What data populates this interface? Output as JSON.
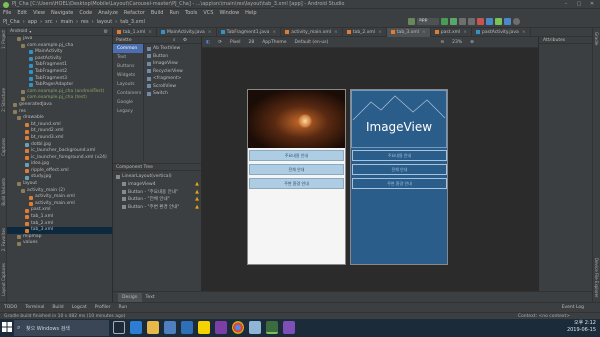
{
  "window": {
    "title": "PJ_Cha [C:\\Users\\HOEL\\Desktop\\Mobile\\Layout\\Carousel-master\\PJ_Cha] - ...\\app\\src\\main\\res\\layout\\tab_3.xml [app] - Android Studio"
  },
  "menu": [
    "File",
    "Edit",
    "View",
    "Navigate",
    "Code",
    "Analyze",
    "Refactor",
    "Build",
    "Run",
    "Tools",
    "VCS",
    "Window",
    "Help"
  ],
  "breadcrumbs": [
    "PJ_Cha",
    "app",
    "src",
    "main",
    "res",
    "layout",
    "tab_3.xml"
  ],
  "run_config": "app",
  "project_panel": {
    "header": "Android",
    "items": [
      {
        "label": "java",
        "indent": 2,
        "kind": "folder"
      },
      {
        "label": "com.example.pj_cha",
        "indent": 3,
        "kind": "package"
      },
      {
        "label": "MainActivity",
        "indent": 5,
        "kind": "class"
      },
      {
        "label": "pastActivity",
        "indent": 5,
        "kind": "class"
      },
      {
        "label": "TabFragment1",
        "indent": 5,
        "kind": "class"
      },
      {
        "label": "TabFragment2",
        "indent": 5,
        "kind": "class"
      },
      {
        "label": "TabFragment3",
        "indent": 5,
        "kind": "class"
      },
      {
        "label": "TabPagerAdapter",
        "indent": 5,
        "kind": "class"
      },
      {
        "label": "com.example.pj_cha (androidTest)",
        "indent": 3,
        "kind": "package"
      },
      {
        "label": "com.example.pj_cha (test)",
        "indent": 3,
        "kind": "package"
      },
      {
        "label": "generatedJava",
        "indent": 1,
        "kind": "folder"
      },
      {
        "label": "res",
        "indent": 1,
        "kind": "folder"
      },
      {
        "label": "drawable",
        "indent": 2,
        "kind": "folder"
      },
      {
        "label": "bt_round.xml",
        "indent": 4,
        "kind": "file"
      },
      {
        "label": "bt_round2.xml",
        "indent": 4,
        "kind": "file"
      },
      {
        "label": "bt_round3.xml",
        "indent": 4,
        "kind": "file"
      },
      {
        "label": "dotbl.jpg",
        "indent": 4,
        "kind": "image"
      },
      {
        "label": "ic_launcher_background.xml",
        "indent": 4,
        "kind": "file"
      },
      {
        "label": "ic_launcher_foreground.xml (v24)",
        "indent": 4,
        "kind": "file"
      },
      {
        "label": "idea.jpg",
        "indent": 4,
        "kind": "image"
      },
      {
        "label": "ripple_effect.xml",
        "indent": 4,
        "kind": "file"
      },
      {
        "label": "study.jpg",
        "indent": 4,
        "kind": "image"
      },
      {
        "label": "layout",
        "indent": 2,
        "kind": "folder"
      },
      {
        "label": "activity_main (2)",
        "indent": 3,
        "kind": "folder"
      },
      {
        "label": "activity_main.xml",
        "indent": 5,
        "kind": "file"
      },
      {
        "label": "activity_main.xml",
        "indent": 5,
        "kind": "file"
      },
      {
        "label": "past.xml",
        "indent": 4,
        "kind": "file"
      },
      {
        "label": "tab_1.xml",
        "indent": 4,
        "kind": "file"
      },
      {
        "label": "tab_2.xml",
        "indent": 4,
        "kind": "file"
      },
      {
        "label": "tab_3.xml",
        "indent": 4,
        "kind": "file",
        "selected": true
      },
      {
        "label": "mipmap",
        "indent": 2,
        "kind": "folder"
      },
      {
        "label": "values",
        "indent": 2,
        "kind": "folder"
      }
    ]
  },
  "left_tool_tabs": [
    "1: Project",
    "2: Structure",
    "Captures",
    "Build Variants",
    "2: Favorites",
    "Layout Captures"
  ],
  "right_tool_tabs": [
    "Gradle",
    "Device File Explorer"
  ],
  "editor_tabs": [
    {
      "label": "tab_1.xml"
    },
    {
      "label": "MainActivity.java"
    },
    {
      "label": "TabFragment1.java"
    },
    {
      "label": "activity_main.xml"
    },
    {
      "label": "tab_2.xml"
    },
    {
      "label": "tab_3.xml",
      "active": true
    },
    {
      "label": "past.xml"
    },
    {
      "label": "pastActivity.java"
    }
  ],
  "palette": {
    "title": "Palette",
    "categories": [
      "Common",
      "Text",
      "Buttons",
      "Widgets",
      "Layouts",
      "Containers",
      "Google",
      "Legacy"
    ],
    "items": [
      "Ab TextView",
      "Button",
      "ImageView",
      "RecyclerView",
      "<fragment>",
      "ScrollView",
      "Switch"
    ]
  },
  "component_tree": {
    "title": "Component Tree",
    "items": [
      {
        "label": "LinearLayout(vertical)",
        "indent": 0,
        "warn": false
      },
      {
        "label": "imageView4",
        "indent": 1,
        "warn": true
      },
      {
        "label": "Button - \"주요내용 안내\"",
        "indent": 1,
        "warn": true
      },
      {
        "label": "Button - \"전체 안내\"",
        "indent": 1,
        "warn": true
      },
      {
        "label": "Button - \"주변 환경 안내\"",
        "indent": 1,
        "warn": true
      }
    ]
  },
  "design_toolbar": {
    "device": "Pixel",
    "api": "28",
    "theme": "AppTheme",
    "locale": "Default (en-us)",
    "zoom": "23%"
  },
  "preview": {
    "buttons": [
      "주요내용 안내",
      "전체 안내",
      "주변 환경 안내"
    ],
    "blueprint_label": "ImageView"
  },
  "attributes": {
    "title": "Attributes"
  },
  "design_tabs": [
    "Design",
    "Text"
  ],
  "tool_windows": [
    "TODO",
    "Terminal",
    "Build",
    "Logcat",
    "Profiler",
    "Run",
    "Event Log"
  ],
  "status": {
    "message": "Gradle build finished in 10 s 482 ms (10 minutes ago)",
    "right": "Context: <no context>"
  },
  "taskbar": {
    "search": "찾으 Windows 검색",
    "time": "오후 2:12",
    "date": "2019-06-15"
  }
}
